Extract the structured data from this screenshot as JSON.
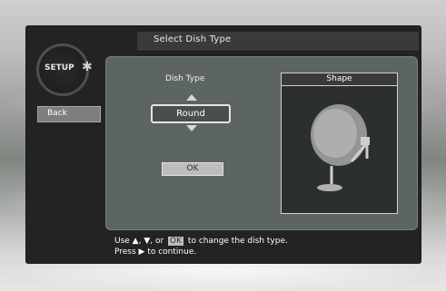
{
  "title": "Select Dish Type",
  "logo": {
    "text": "SETUP"
  },
  "sidebar": {
    "back_label": "Back"
  },
  "dish": {
    "label": "Dish Type",
    "selected": "Round",
    "ok_label": "OK"
  },
  "shape": {
    "label": "Shape"
  },
  "help": {
    "line1_prefix": "Use ▲, ▼, or",
    "line1_chip": "OK",
    "line1_suffix": "to change the dish type.",
    "line2": "Press ▶ to continue."
  },
  "colors": {
    "frame": "#232323",
    "panel": "#6e7873",
    "button": "#bdbdbd"
  },
  "icons": {
    "logo": "gear-icon",
    "up": "arrow-up-icon",
    "down": "arrow-down-icon",
    "dish_preview": "satellite-dish-icon"
  }
}
